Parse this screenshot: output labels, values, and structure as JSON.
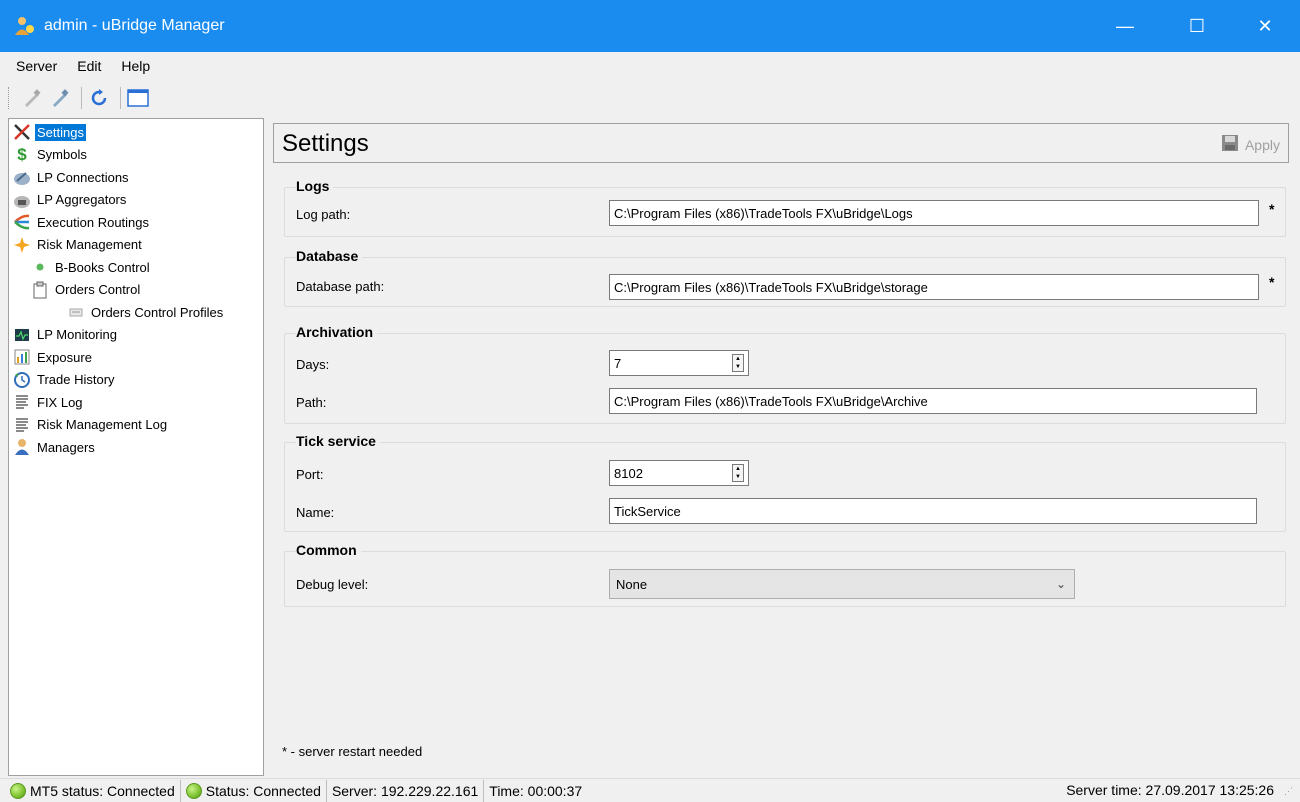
{
  "window": {
    "title": "admin - uBridge Manager",
    "controls": {
      "minimize": "—",
      "maximize": "☐",
      "close": "✕"
    }
  },
  "menu": [
    "Server",
    "Edit",
    "Help"
  ],
  "toolbar": {
    "buttons": [
      "connect-icon",
      "disconnect-icon",
      "refresh-icon",
      "window-icon"
    ]
  },
  "tree": {
    "items": [
      {
        "label": "Settings",
        "icon": "tools-icon",
        "level": 0,
        "selected": true
      },
      {
        "label": "Symbols",
        "icon": "dollar-icon",
        "level": 0
      },
      {
        "label": "LP Connections",
        "icon": "plug-icon",
        "level": 0
      },
      {
        "label": "LP Aggregators",
        "icon": "aggregator-icon",
        "level": 0
      },
      {
        "label": "Execution Routings",
        "icon": "routing-icon",
        "level": 0
      },
      {
        "label": "Risk Management",
        "icon": "risk-icon",
        "level": 0
      },
      {
        "label": "B-Books Control",
        "icon": "bullet-icon",
        "level": 1
      },
      {
        "label": "Orders Control",
        "icon": "clipboard-icon",
        "level": 1
      },
      {
        "label": "Orders Control Profiles",
        "icon": "profile-icon",
        "level": 2
      },
      {
        "label": "LP Monitoring",
        "icon": "monitor-icon",
        "level": 0
      },
      {
        "label": "Exposure",
        "icon": "chart-icon",
        "level": 0
      },
      {
        "label": "Trade History",
        "icon": "history-icon",
        "level": 0
      },
      {
        "label": "FIX Log",
        "icon": "log-icon",
        "level": 0
      },
      {
        "label": "Risk Management Log",
        "icon": "log-icon",
        "level": 0
      },
      {
        "label": "Managers",
        "icon": "user-icon",
        "level": 0
      }
    ]
  },
  "main": {
    "title": "Settings",
    "apply_label": "Apply",
    "groups": {
      "logs": {
        "title": "Logs",
        "log_path_label": "Log path:",
        "log_path_value": "C:\\Program Files (x86)\\TradeTools FX\\uBridge\\Logs",
        "restart_mark": "*"
      },
      "database": {
        "title": "Database",
        "db_path_label": "Database path:",
        "db_path_value": "C:\\Program Files (x86)\\TradeTools FX\\uBridge\\storage",
        "restart_mark": "*"
      },
      "archivation": {
        "title": "Archivation",
        "days_label": "Days:",
        "days_value": "7",
        "path_label": "Path:",
        "path_value": "C:\\Program Files (x86)\\TradeTools FX\\uBridge\\Archive"
      },
      "tick_service": {
        "title": "Tick service",
        "port_label": "Port:",
        "port_value": "8102",
        "name_label": "Name:",
        "name_value": "TickService"
      },
      "common": {
        "title": "Common",
        "debug_label": "Debug level:",
        "debug_value": "None"
      }
    },
    "footnote": "* - server restart needed"
  },
  "status": {
    "mt5": "MT5 status: Connected",
    "status": "Status: Connected",
    "server": "Server: 192.229.22.161",
    "time": "Time: 00:00:37",
    "server_time": "Server time: 27.09.2017 13:25:26"
  },
  "colors": {
    "titlebar": "#1a8cf0",
    "selection": "#0078d7",
    "status_ok": "#7cc22e"
  }
}
